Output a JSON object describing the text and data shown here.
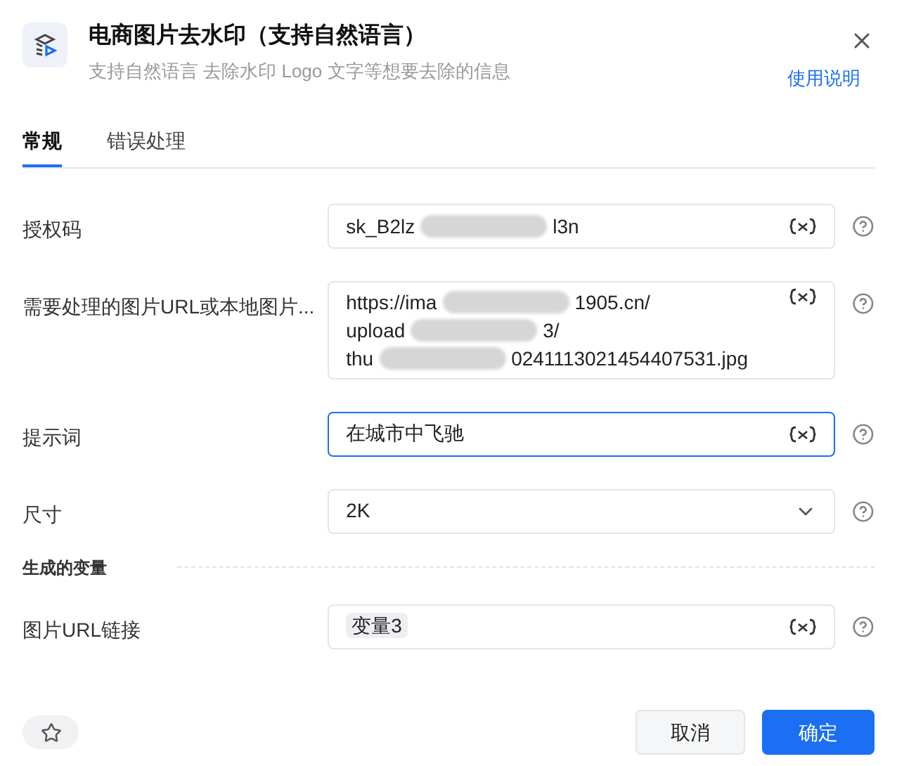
{
  "header": {
    "title": "电商图片去水印（支持自然语言）",
    "subtitle": "支持自然语言 去除水印 Logo 文字等想要去除的信息",
    "help_link": "使用说明"
  },
  "tabs": [
    {
      "label": "常规",
      "selected": true
    },
    {
      "label": "错误处理",
      "selected": false
    }
  ],
  "fields": [
    {
      "kind": "redacted",
      "label": "授权码",
      "focused": false,
      "lines": [
        [
          "sk_B2lz",
          "l3n"
        ]
      ]
    },
    {
      "kind": "redacted",
      "label": "需要处理的图片URL或本地图片...",
      "focused": false,
      "lines": [
        [
          "https://ima",
          "1905.cn/"
        ],
        [
          "upload",
          "3/"
        ],
        [
          "thu",
          "0241113021454407531.jpg"
        ]
      ]
    },
    {
      "kind": "text",
      "label": "提示词",
      "focused": true,
      "value": "在城市中飞驰"
    },
    {
      "kind": "select",
      "label": "尺寸",
      "focused": false,
      "value": "2K"
    }
  ],
  "section": {
    "title": "生成的变量"
  },
  "outputs": [
    {
      "kind": "tag",
      "label": "图片URL链接",
      "focused": false,
      "value": "变量3"
    }
  ],
  "footer": {
    "cancel": "取消",
    "confirm": "确定"
  }
}
